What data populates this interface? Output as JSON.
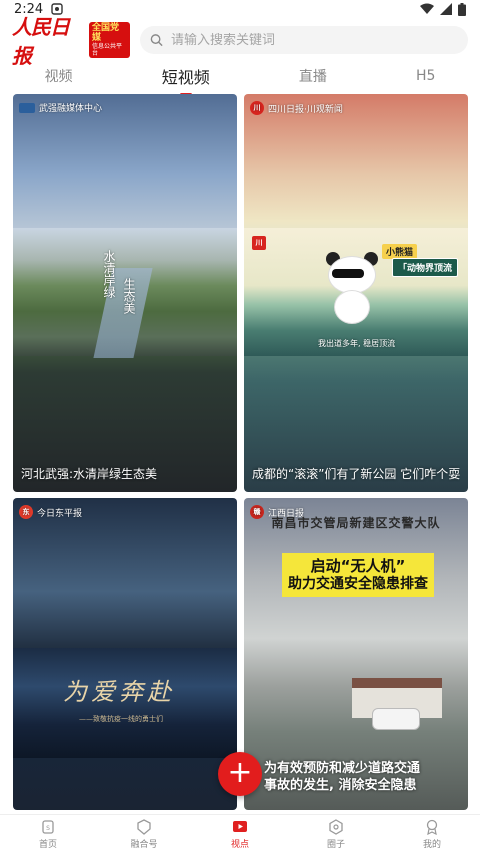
{
  "status_bar": {
    "time": "2:24"
  },
  "header": {
    "logo_text": "人民日报",
    "logo_badge_main": "全国党媒",
    "logo_badge_sub": "信息公共平台",
    "search_placeholder": "请输入搜索关键词"
  },
  "tabs": [
    {
      "label": "视频",
      "active": false
    },
    {
      "label": "短视频",
      "active": true
    },
    {
      "label": "直播",
      "active": false
    },
    {
      "label": "H5",
      "active": false
    }
  ],
  "cards": [
    {
      "source": "武强融媒体中心",
      "title": "河北武强:水清岸绿生态美",
      "overlay_text_1": "水清岸绿",
      "overlay_text_2": "生态美"
    },
    {
      "source": "四川日报·川观新闻",
      "title": "成都的“滚滚”们有了新公园 它们咋个耍",
      "tag_yellow": "小熊猫",
      "tag_green": "「动物界顶流",
      "caption": "我出道多年, 稳居顶流"
    },
    {
      "source": "今日东平报",
      "title": "",
      "overlay_title": "为爱奔赴",
      "overlay_sub": "——致敬抗疫一线的勇士们"
    },
    {
      "source": "江西日报",
      "title": "",
      "top_text": "南昌市交管局新建区交警大队",
      "banner_line1": "启动“无人机”",
      "banner_line2": "助力交通安全隐患排查",
      "bottom_line1": "为有效预防和减少道路交通",
      "bottom_line2": "事故的发生, 消除安全隐患"
    }
  ],
  "fab": {
    "label": "+"
  },
  "bottom_nav": [
    {
      "label": "首页",
      "icon": "home-icon",
      "active": false
    },
    {
      "label": "融合号",
      "icon": "fusion-icon",
      "active": false
    },
    {
      "label": "视点",
      "icon": "video-icon",
      "active": true
    },
    {
      "label": "圈子",
      "icon": "circle-icon",
      "active": false
    },
    {
      "label": "我的",
      "icon": "profile-icon",
      "active": false
    }
  ],
  "colors": {
    "accent": "#e02020",
    "brand_red": "#d60f0f"
  }
}
